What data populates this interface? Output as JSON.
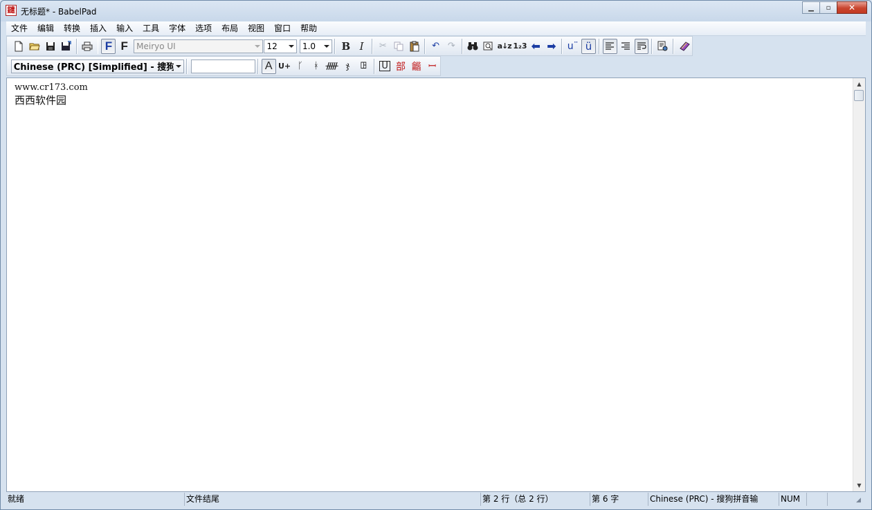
{
  "window": {
    "title": "无标题* - BabelPad",
    "app_icon_glyph": "鑓"
  },
  "window_buttons": {
    "minimize": "▁",
    "maximize": "▫",
    "close": "✕"
  },
  "menu": [
    "文件",
    "编辑",
    "转换",
    "插入",
    "输入",
    "工具",
    "字体",
    "选项",
    "布局",
    "视图",
    "窗口",
    "帮助"
  ],
  "toolbar1": {
    "font_name": "Meiryo UI",
    "font_size": "12",
    "line_spacing": "1.0",
    "font_toggle_bold_f": "F",
    "font_toggle_f": "F",
    "bold": "B",
    "italic": "I",
    "sort_label": "a↓z",
    "number_label": "1₂3",
    "combine_label": "u¨",
    "precomposed_label": "ü"
  },
  "toolbar2": {
    "language": "Chinese (PRC) [Simplified] - 搜狗拼",
    "input_value": "",
    "char_a": "A",
    "unicode_plus": "U+",
    "underline_u": "U",
    "radical": "部",
    "radical2": "龤",
    "glyph1": "ꟷ",
    "glyph2": "ꖸ",
    "glyph3": "ᚏ",
    "glyph4": "ჯ",
    "glyph5": "ᚴ",
    "glyph6": "ᚼ"
  },
  "document": {
    "lines": [
      "www.cr173.com",
      "西西软件园"
    ]
  },
  "statusbar": {
    "ready": "就绪",
    "eof": "文件结尾",
    "line_info": "第 2 行（总 2 行）",
    "char_info": "第 6 字",
    "input_method": "Chinese (PRC) - 搜狗拼音输",
    "num": "NUM"
  },
  "colors": {
    "accent": "#c01818",
    "chrome": "#d9e4f1",
    "close": "#c9452e"
  }
}
